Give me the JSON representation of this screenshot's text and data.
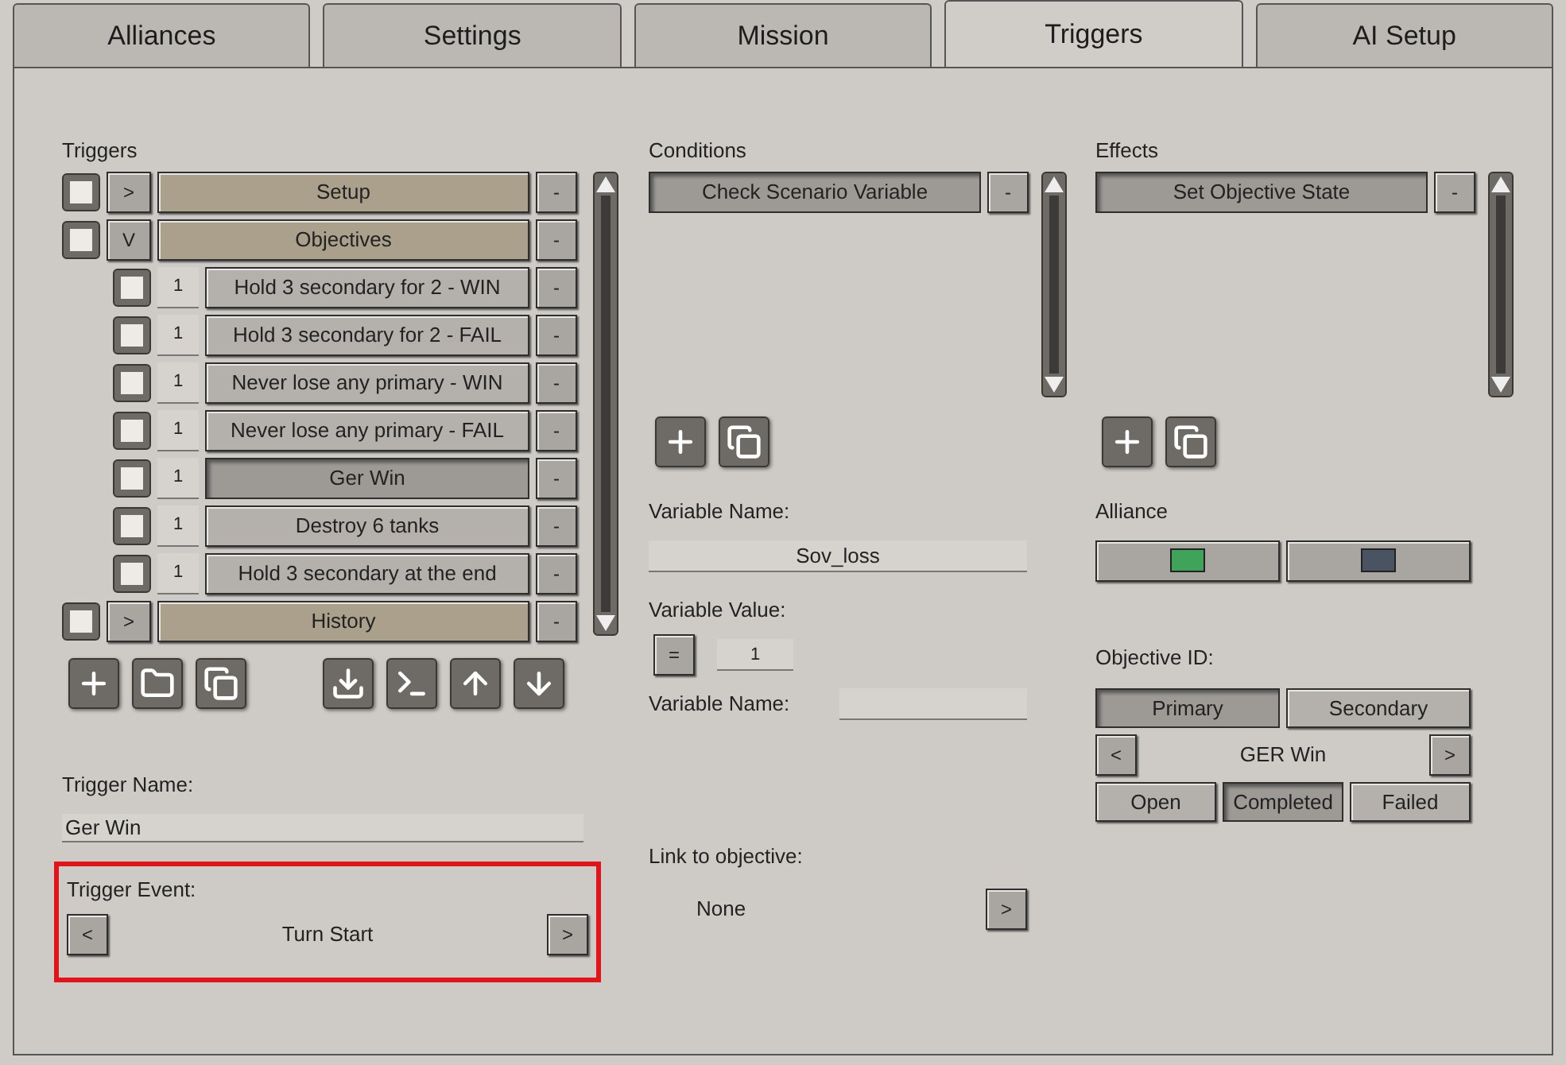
{
  "tabs": [
    {
      "label": "Alliances",
      "selected": false
    },
    {
      "label": "Settings",
      "selected": false
    },
    {
      "label": "Mission",
      "selected": false
    },
    {
      "label": "Triggers",
      "selected": true
    },
    {
      "label": "AI Setup",
      "selected": false
    }
  ],
  "triggers": {
    "title": "Triggers",
    "items": [
      {
        "label": "Setup",
        "toggle": ">",
        "checked": false,
        "selected": false,
        "remove": "-"
      },
      {
        "label": "Objectives",
        "toggle": "V",
        "checked": false,
        "selected": false,
        "remove": "-",
        "children": [
          {
            "order": "1",
            "label": "Hold 3 secondary for 2 - WIN",
            "checked": false,
            "selected": false,
            "remove": "-"
          },
          {
            "order": "1",
            "label": "Hold 3 secondary for 2  - FAIL",
            "checked": false,
            "selected": false,
            "remove": "-"
          },
          {
            "order": "1",
            "label": "Never lose any primary - WIN",
            "checked": false,
            "selected": false,
            "remove": "-"
          },
          {
            "order": "1",
            "label": "Never lose any primary - FAIL",
            "checked": false,
            "selected": false,
            "remove": "-"
          },
          {
            "order": "1",
            "label": "Ger Win",
            "checked": false,
            "selected": true,
            "remove": "-"
          },
          {
            "order": "1",
            "label": "Destroy 6 tanks",
            "checked": false,
            "selected": false,
            "remove": "-"
          },
          {
            "order": "1",
            "label": "Hold 3 secondary at the end",
            "checked": false,
            "selected": false,
            "remove": "-"
          }
        ]
      },
      {
        "label": "History",
        "toggle": ">",
        "checked": false,
        "selected": false,
        "remove": "-"
      }
    ]
  },
  "trigger_name": {
    "label": "Trigger Name:",
    "value": "Ger Win"
  },
  "trigger_event": {
    "label": "Trigger Event:",
    "prev": "<",
    "value": "Turn Start",
    "next": ">",
    "highlighted": true
  },
  "conditions": {
    "title": "Conditions",
    "items": [
      {
        "label": "Check Scenario Variable",
        "selected": true,
        "remove": "-"
      }
    ]
  },
  "variable_name": {
    "label": "Variable Name:",
    "value": "Sov_loss"
  },
  "variable_value": {
    "label": "Variable Value:",
    "operator": "=",
    "value": "1"
  },
  "variable_name_2": {
    "label": "Variable Name:"
  },
  "link_to_objective": {
    "label": "Link to objective:",
    "value": "None",
    "next": ">"
  },
  "effects": {
    "title": "Effects",
    "items": [
      {
        "label": "Set Objective State",
        "selected": true,
        "remove": "-"
      }
    ]
  },
  "alliance": {
    "label": "Alliance",
    "options": [
      {
        "color": "#3fa35a"
      },
      {
        "color": "#4a5361"
      }
    ]
  },
  "objective_id": {
    "label": "Objective ID:",
    "types": [
      {
        "label": "Primary",
        "selected": true
      },
      {
        "label": "Secondary",
        "selected": false
      }
    ],
    "prev": "<",
    "value": "GER Win",
    "next": ">",
    "states": [
      {
        "label": "Open",
        "selected": false
      },
      {
        "label": "Completed",
        "selected": true
      },
      {
        "label": "Failed",
        "selected": false
      }
    ]
  }
}
